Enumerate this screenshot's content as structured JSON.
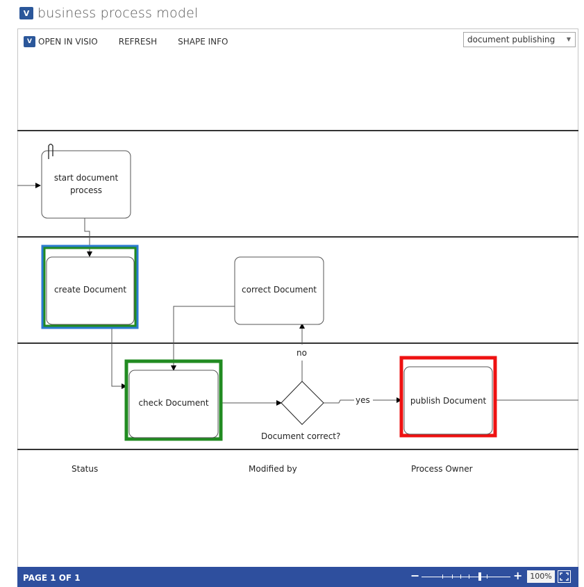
{
  "app": {
    "logo": "V",
    "title": "business process model"
  },
  "toolbar": {
    "open_in_visio": "OPEN IN VISIO",
    "refresh": "REFRESH",
    "shape_info": "SHAPE INFO",
    "page_select": "document publishing"
  },
  "diagram": {
    "shapes": {
      "start": "start document process",
      "create": "create Document",
      "correct": "correct Document",
      "check": "check Document",
      "decision": "Document correct?",
      "publish": "publish Document"
    },
    "connector_labels": {
      "no": "no",
      "yes": "yes"
    },
    "highlight_colors": {
      "create_outer": "#2b7bd0",
      "create_inner": "#218b21",
      "check": "#218b21",
      "publish": "#ee1111"
    }
  },
  "data_fields": {
    "status": "Status",
    "modified_by": "Modified by",
    "process_owner": "Process Owner"
  },
  "status_bar": {
    "page": "PAGE 1 OF 1",
    "zoom_minus": "−",
    "zoom_plus": "+",
    "zoom_level": "100%",
    "fit_icon": "fit-to-window-icon"
  }
}
